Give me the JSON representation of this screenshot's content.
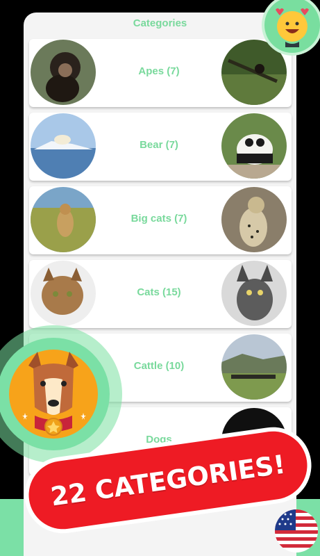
{
  "header": {
    "title": "Categories"
  },
  "categories": [
    {
      "label": "Apes (7)"
    },
    {
      "label": "Bear (7)"
    },
    {
      "label": "Big cats (7)"
    },
    {
      "label": "Cats (15)"
    },
    {
      "label": "Cattle (10)"
    },
    {
      "label": "Dogs"
    }
  ],
  "promo": {
    "banner_text": "22 CATEGORIES!"
  },
  "colors": {
    "accent": "#79d99c",
    "banner": "#ee1b24",
    "band": "#7be0a6"
  },
  "icons": {
    "top_right": "happy-emoji-icon",
    "left_badge": "dog-medal-icon",
    "bottom_right": "us-flag-icon"
  }
}
